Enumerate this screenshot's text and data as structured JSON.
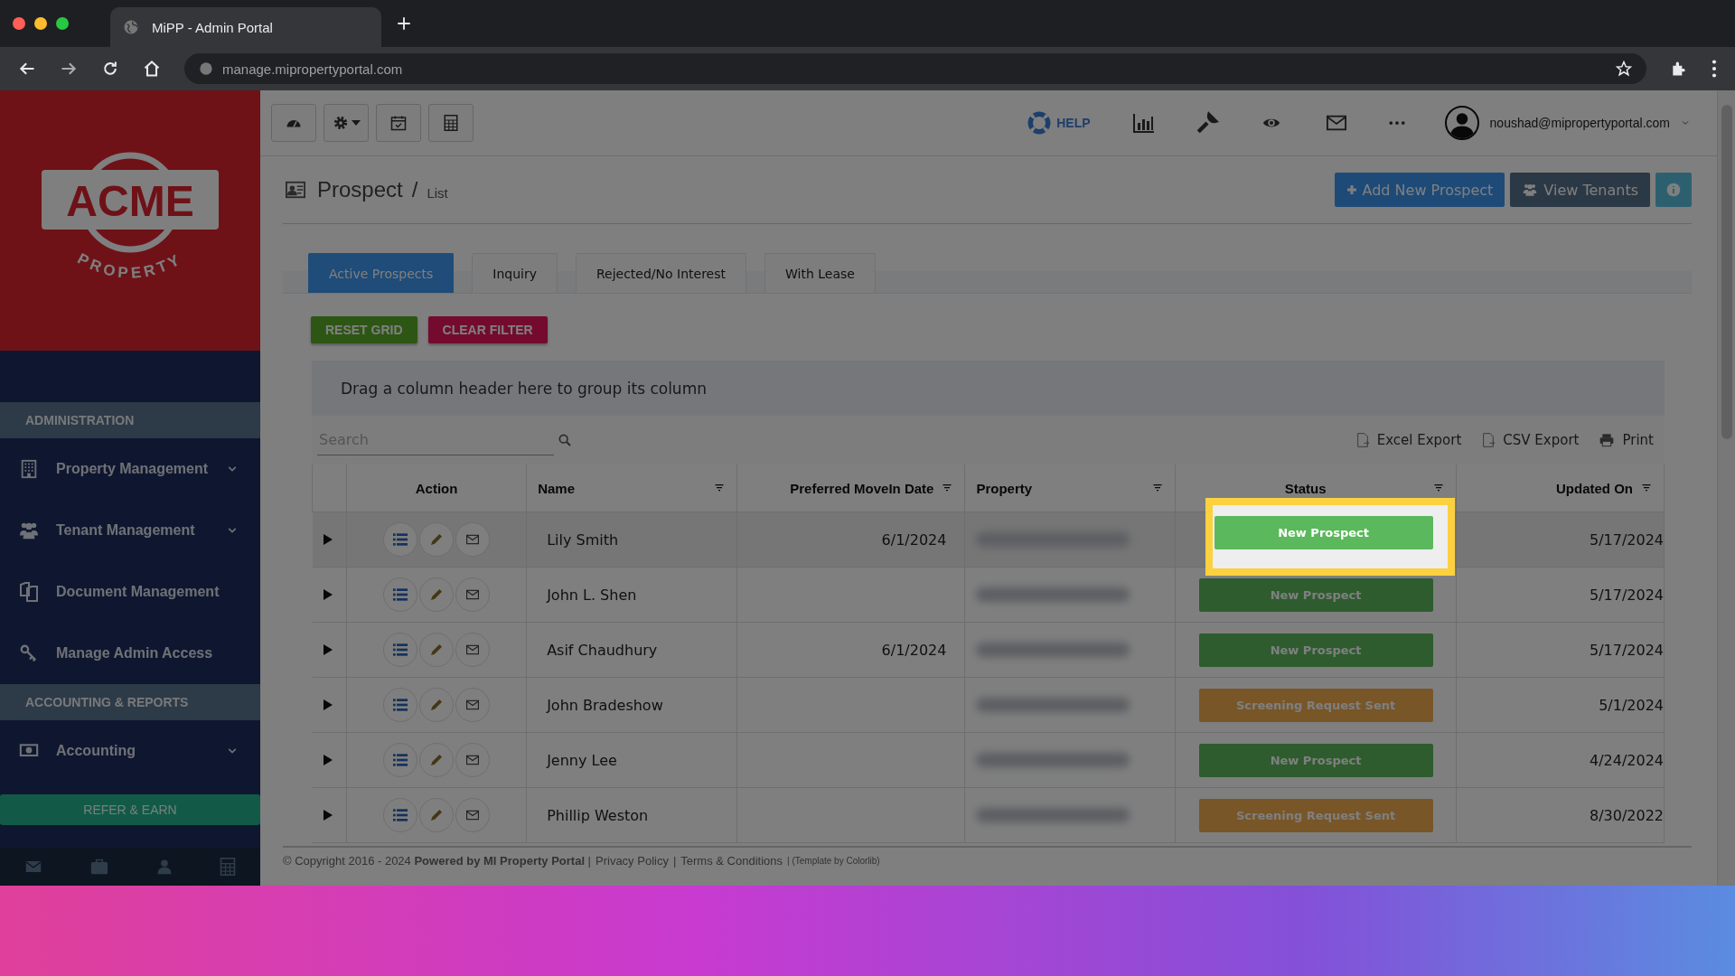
{
  "browser": {
    "tab_title": "MiPP - Admin Portal",
    "url": "manage.mipropertyportal.com"
  },
  "sidebar": {
    "logo": {
      "wordmark": "ACME",
      "tagline": "PROPERTY"
    },
    "sections": [
      {
        "title": "ADMINISTRATION",
        "items": [
          {
            "label": "Property Management",
            "kind": "building",
            "expandable": true
          },
          {
            "label": "Tenant Management",
            "kind": "users",
            "expandable": true
          },
          {
            "label": "Document Management",
            "kind": "documents",
            "expandable": false
          },
          {
            "label": "Manage Admin Access",
            "kind": "key",
            "expandable": false
          }
        ]
      },
      {
        "title": "ACCOUNTING & REPORTS",
        "items": [
          {
            "label": "Accounting",
            "kind": "money",
            "expandable": true
          }
        ]
      }
    ],
    "refer_button": "REFER & EARN"
  },
  "toolbar": {
    "help_label": "HELP",
    "user_email": "noushad@mipropertyportal.com"
  },
  "header": {
    "title": "Prospect",
    "separator": "/",
    "subtitle": "List",
    "buttons": [
      {
        "kind": "primary",
        "label": "Add New Prospect"
      },
      {
        "kind": "dark",
        "label": "View Tenants"
      },
      {
        "kind": "info"
      }
    ]
  },
  "tabs": [
    {
      "label": "Active Prospects",
      "selected": true
    },
    {
      "label": "Inquiry",
      "selected": false
    },
    {
      "label": "Rejected/No Interest",
      "selected": false
    },
    {
      "label": "With Lease",
      "selected": false
    }
  ],
  "grid_buttons": [
    {
      "kind": "reset",
      "label": "RESET GRID"
    },
    {
      "kind": "clear",
      "label": "CLEAR FILTER"
    }
  ],
  "group_panel": "Drag a column header here to group its column",
  "search": {
    "placeholder": "Search"
  },
  "exports": [
    {
      "kind": "excel",
      "label": "Excel Export"
    },
    {
      "kind": "csv",
      "label": "CSV Export"
    },
    {
      "kind": "print",
      "label": "Print"
    }
  ],
  "table": {
    "columns": [
      {
        "label": "Action",
        "filter": false
      },
      {
        "label": "Name",
        "filter": true
      },
      {
        "label": "Preferred MoveIn Date",
        "filter": true
      },
      {
        "label": "Property",
        "filter": true
      },
      {
        "label": "Status",
        "filter": true
      },
      {
        "label": "Updated On",
        "filter": true
      }
    ],
    "rows": [
      {
        "name": "Lily Smith",
        "movein": "6/1/2024",
        "status": {
          "label": "New Prospect",
          "kind": "new"
        },
        "updated": "5/17/2024",
        "highlighted": true
      },
      {
        "name": "John L. Shen",
        "status": {
          "label": "New Prospect",
          "kind": "new"
        },
        "updated": "5/17/2024",
        "highlighted": false
      },
      {
        "name": "Asif Chaudhury",
        "movein": "6/1/2024",
        "status": {
          "label": "New Prospect",
          "kind": "new"
        },
        "updated": "5/17/2024",
        "highlighted": false
      },
      {
        "name": "John Bradeshow",
        "status": {
          "label": "Screening Request Sent",
          "kind": "screening"
        },
        "updated": "5/1/2024",
        "highlighted": false
      },
      {
        "name": "Jenny Lee",
        "status": {
          "label": "New Prospect",
          "kind": "new"
        },
        "updated": "4/24/2024",
        "highlighted": false
      },
      {
        "name": "Phillip Weston",
        "status": {
          "label": "Screening Request Sent",
          "kind": "screening"
        },
        "updated": "8/30/2022",
        "highlighted": false
      }
    ]
  },
  "footer": [
    {
      "kind": "text",
      "text": "© Copyright 2016 - 2024 **Powered by MI Property Portal** |"
    },
    {
      "kind": "link",
      "text": "Privacy Policy"
    },
    {
      "kind": "text",
      "text": "|"
    },
    {
      "kind": "link",
      "text": "Terms & Conditions"
    },
    {
      "kind": "small",
      "text": "| (Template by Colorlib)"
    }
  ]
}
